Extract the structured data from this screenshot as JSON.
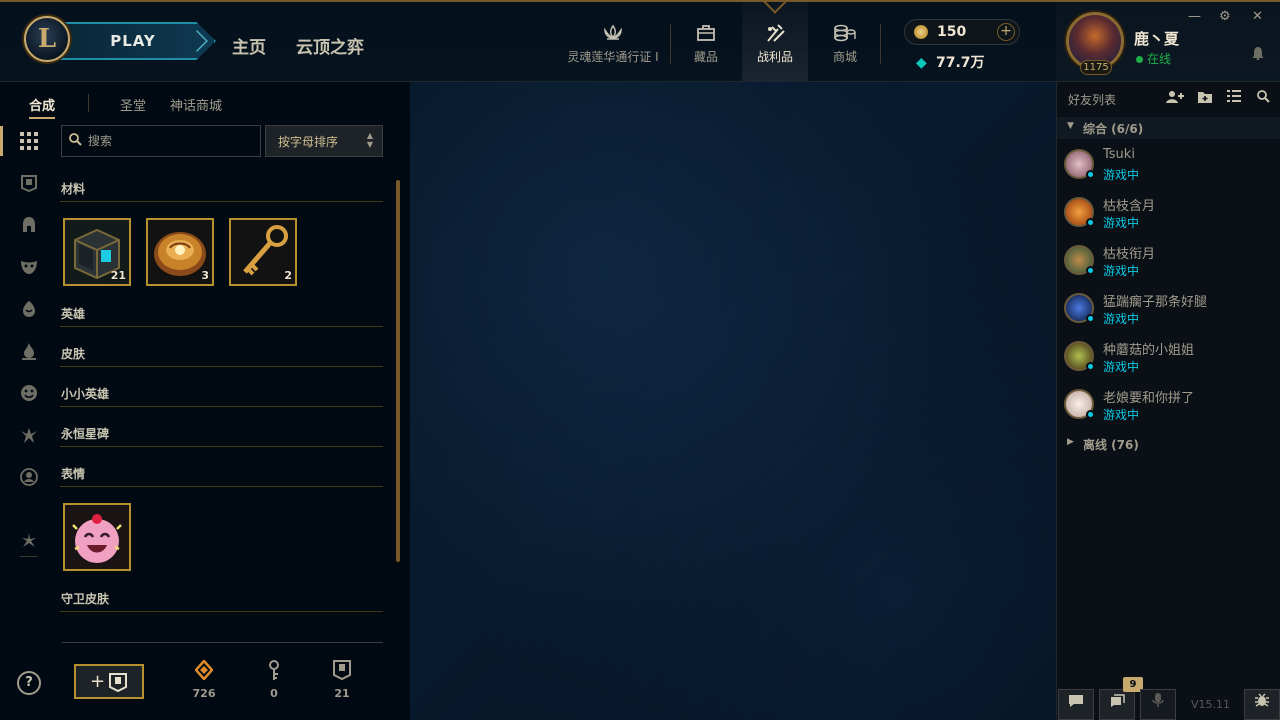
{
  "topbar": {
    "play_label": "PLAY",
    "nav_home": "主页",
    "nav_tft": "云顶之弈",
    "icons": [
      {
        "label": "灵魂莲华通行证 I",
        "icon": "lotus-icon"
      },
      {
        "label": "藏品",
        "icon": "collection-icon"
      },
      {
        "label": "战利品",
        "icon": "loot-icon"
      },
      {
        "label": "商城",
        "icon": "store-icon"
      }
    ],
    "rp": "150",
    "be": "77.7万"
  },
  "profile": {
    "name": "鹿丶夏",
    "status": "在线",
    "level": "1175"
  },
  "loot": {
    "subtabs": [
      "合成",
      "圣堂",
      "神话商城"
    ],
    "search_placeholder": "搜索",
    "sort_label": "按字母排序",
    "categories": [
      "材料",
      "英雄",
      "皮肤",
      "小小英雄",
      "永恒星碑",
      "表情",
      "守卫皮肤"
    ],
    "materials": [
      {
        "name": "hextech-chest",
        "count": "21"
      },
      {
        "name": "orb",
        "count": "3"
      },
      {
        "name": "key",
        "count": "2"
      }
    ],
    "bottom": {
      "craft_label": "+",
      "resources": [
        {
          "icon": "essence-icon",
          "value": "726"
        },
        {
          "icon": "key-fragment-icon",
          "value": "0"
        },
        {
          "icon": "chest-icon",
          "value": "21"
        }
      ]
    }
  },
  "friends": {
    "title": "好友列表",
    "group_general": "综合 (6/6)",
    "group_offline": "离线 (76)",
    "list": [
      {
        "name": "Tsuki",
        "status": "游戏中",
        "color": "#b27a8a"
      },
      {
        "name": "枯枝含月",
        "status": "游戏中",
        "color": "#c8641e"
      },
      {
        "name": "枯枝衔月",
        "status": "游戏中",
        "color": "#8a6a3a"
      },
      {
        "name": "猛踹瘸子那条好腿",
        "status": "游戏中",
        "color": "#2a4a9a"
      },
      {
        "name": "种蘑菇的小姐姐",
        "status": "游戏中",
        "color": "#6a8a2a"
      },
      {
        "name": "老娘要和你拼了",
        "status": "游戏中",
        "color": "#d8c8b8"
      }
    ],
    "chat_badge": "9",
    "version": "V15.11"
  },
  "colors": {
    "gold": "#c8aa6e",
    "online_green": "#1eb14b",
    "ingame_blue": "#0acbe6"
  }
}
